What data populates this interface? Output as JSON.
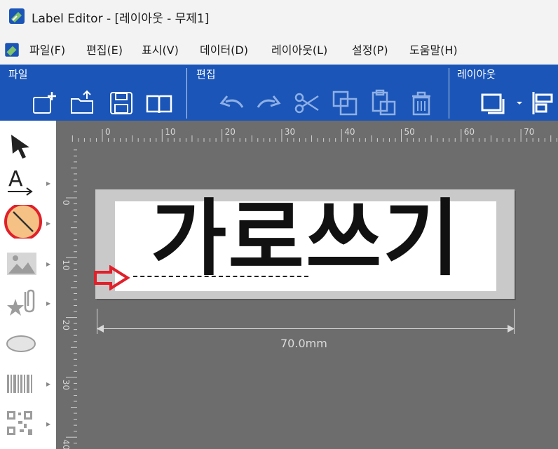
{
  "window": {
    "title": "Label Editor - [레이아웃  - 무제1]"
  },
  "menu": {
    "items": [
      "파일(F)",
      "편집(E)",
      "표시(V)",
      "데이터(D)",
      "레이아웃(L)",
      "설정(P)",
      "도움말(H)"
    ]
  },
  "ribbon": {
    "groups": {
      "file": "파일",
      "edit": "편집",
      "layout": "레이아웃"
    },
    "file_buttons": [
      "new-label-icon",
      "open-folder-icon",
      "save-icon",
      "book-icon"
    ],
    "edit_buttons": [
      "undo-icon",
      "redo-icon",
      "cut-icon",
      "copy-icon",
      "paste-icon",
      "delete-icon"
    ],
    "layout_buttons": [
      "frame-icon",
      "chevron-down-icon",
      "align-icon"
    ]
  },
  "toolbox": {
    "tools": [
      "select-arrow-icon",
      "text-tool-icon",
      "line-tool-icon",
      "image-tool-icon",
      "clipart-tool-icon",
      "ellipse-tool-icon",
      "barcode-tool-icon",
      "qrcode-tool-icon"
    ],
    "highlighted_tool": "line-tool-icon",
    "highlight_color": "#e0202a"
  },
  "ruler": {
    "horizontal_ticks": [
      "0",
      "10",
      "20",
      "30",
      "40",
      "50",
      "60",
      "70"
    ],
    "vertical_ticks": [
      "0",
      "10",
      "20",
      "30",
      "40"
    ]
  },
  "label": {
    "text": "가로쓰기",
    "width_label": "70.0mm"
  },
  "colors": {
    "ribbon": "#1a55b7",
    "canvas": "#6d6d6d",
    "pointer_arrow": "#e0202a"
  }
}
